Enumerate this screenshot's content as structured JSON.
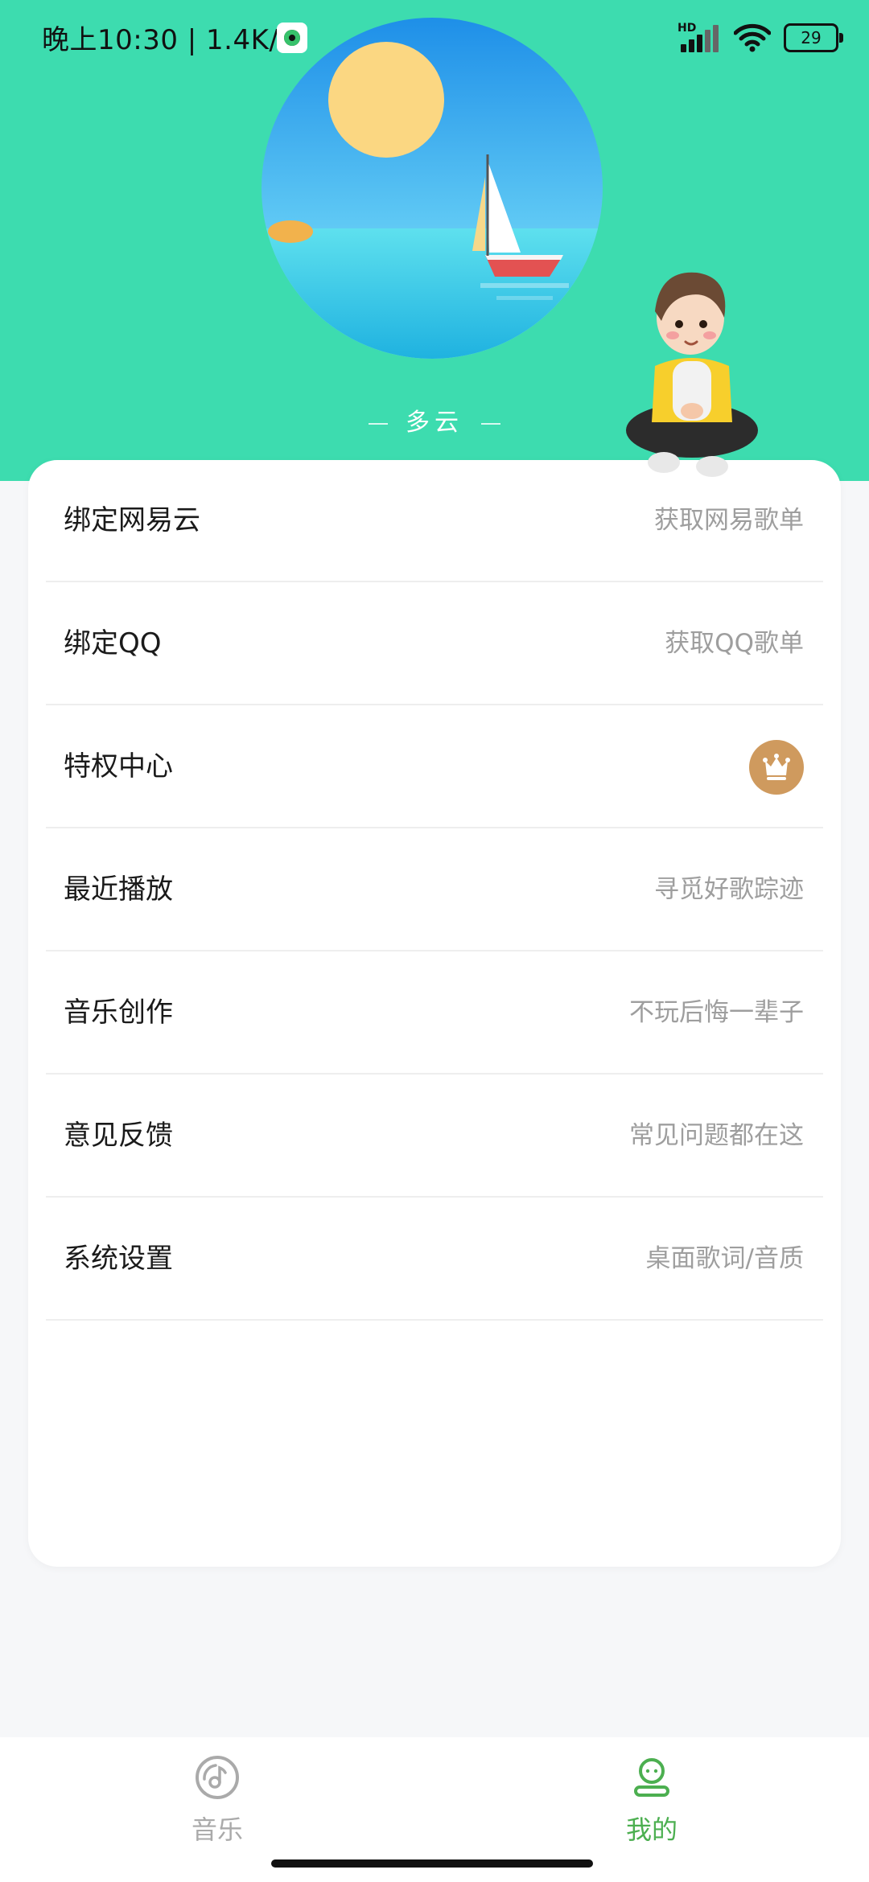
{
  "status_bar": {
    "time": "晚上10:30 | 1.4K/s",
    "network": "HD",
    "battery": "29"
  },
  "weather": {
    "label": "多云"
  },
  "menu": {
    "items": [
      {
        "label": "绑定网易云",
        "hint": "获取网易歌单"
      },
      {
        "label": "绑定QQ",
        "hint": "获取QQ歌单"
      },
      {
        "label": "特权中心",
        "icon": "crown-icon"
      },
      {
        "label": "最近播放",
        "hint": "寻觅好歌踪迹"
      },
      {
        "label": "音乐创作",
        "hint": "不玩后悔一辈子"
      },
      {
        "label": "意见反馈",
        "hint": "常见问题都在这"
      },
      {
        "label": "系统设置",
        "hint": "桌面歌词/音质"
      }
    ]
  },
  "bottom_nav": {
    "tabs": [
      {
        "label": "音乐",
        "icon": "music-disc-icon",
        "active": false
      },
      {
        "label": "我的",
        "icon": "profile-icon",
        "active": true
      }
    ]
  },
  "colors": {
    "header_bg": "#3ddcaf",
    "active_tab": "#4caf50",
    "inactive_tab": "#aaaaaa",
    "crown_badge": "#cf9a5e"
  }
}
